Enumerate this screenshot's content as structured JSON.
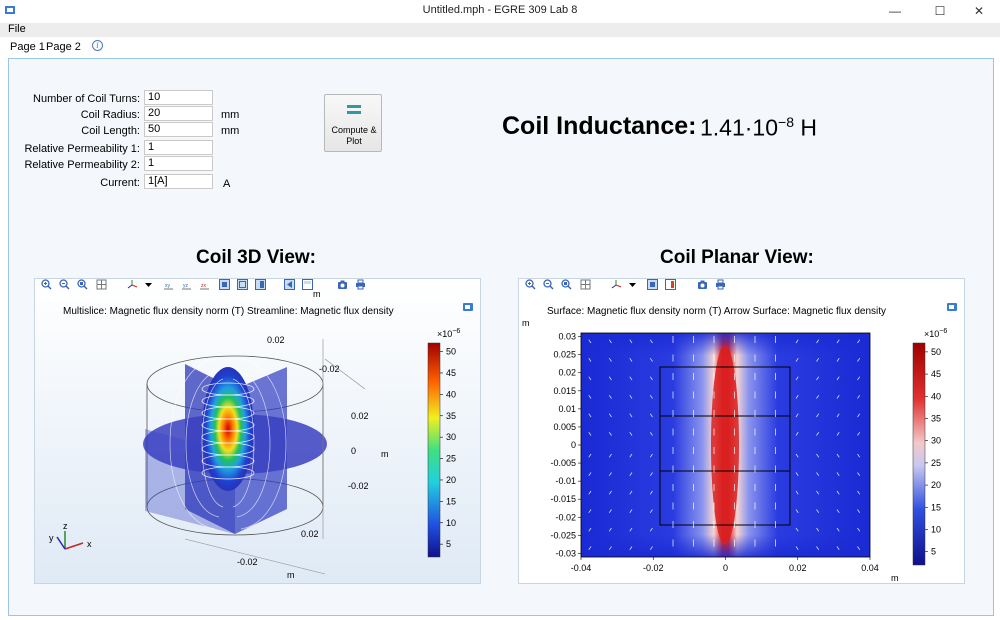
{
  "window": {
    "title": "Untitled.mph - EGRE 309 Lab 8",
    "minimize": "—",
    "maximize": "☐",
    "close": "✕"
  },
  "menu": {
    "file": "File"
  },
  "tabs": [
    {
      "label": "Page 1"
    },
    {
      "label": "Page 2"
    }
  ],
  "form": {
    "fields": [
      {
        "label": "Number of Coil Turns:",
        "value": "10",
        "unit": ""
      },
      {
        "label": "Coil Radius:",
        "value": "20",
        "unit": "mm"
      },
      {
        "label": "Coil Length:",
        "value": "50",
        "unit": "mm"
      },
      {
        "label": "Relative Permeability 1:",
        "value": "1",
        "unit": ""
      },
      {
        "label": "Relative Permeability 2:",
        "value": "1",
        "unit": ""
      },
      {
        "label": "Current:",
        "value": "1[A]",
        "unit": "A"
      }
    ],
    "compute_label_1": "Compute &",
    "compute_label_2": "Plot"
  },
  "result": {
    "label": "Coil Inductance:",
    "mantissa": "1.41·10",
    "exponent": "−8",
    "unit": "H"
  },
  "view3d": {
    "heading": "Coil 3D View:",
    "title": "Multislice: Magnetic flux density norm (T)  Streamline: Magnetic flux density",
    "axis_unit": "m",
    "axis_ticks": [
      "0.02",
      "-0.02",
      "0.02",
      "0",
      "-0.02",
      "0.02",
      "-0.02"
    ],
    "triad": {
      "x": "x",
      "y": "y",
      "z": "z"
    },
    "colorbar": {
      "multiplier": "×10",
      "multiplier_exp": "−6",
      "ticks": [
        "50",
        "45",
        "40",
        "35",
        "30",
        "25",
        "20",
        "15",
        "10",
        "5"
      ]
    }
  },
  "planar": {
    "heading": "Coil Planar View:",
    "title": "Surface: Magnetic flux density norm (T)  Arrow Surface: Magnetic flux density",
    "y_unit": "m",
    "x_unit": "m",
    "colorbar": {
      "multiplier": "×10",
      "multiplier_exp": "−6",
      "ticks": [
        "50",
        "45",
        "40",
        "35",
        "30",
        "25",
        "20",
        "15",
        "10",
        "5"
      ]
    }
  },
  "chart_data": {
    "type": "heatmap",
    "title": "Surface: Magnetic flux density norm (T)  Arrow Surface: Magnetic flux density",
    "xlabel": "m",
    "ylabel": "m",
    "x_ticks": [
      "-0.04",
      "-0.02",
      "0",
      "0.02",
      "0.04"
    ],
    "y_ticks": [
      "0.03",
      "0.025",
      "0.02",
      "0.015",
      "0.01",
      "0.005",
      "0",
      "-0.005",
      "-0.01",
      "-0.015",
      "-0.02",
      "-0.025",
      "-0.03"
    ],
    "xlim": [
      -0.04,
      0.04
    ],
    "ylim": [
      -0.031,
      0.031
    ],
    "colorbar_range": [
      2,
      52
    ],
    "colorbar_multiplier": "×10^-6"
  },
  "colors": {
    "panel_border": "#9cc4e6",
    "accent_teal": "#2c9a9e",
    "field_blue": "#1a2fd0",
    "field_red": "#e02020"
  }
}
